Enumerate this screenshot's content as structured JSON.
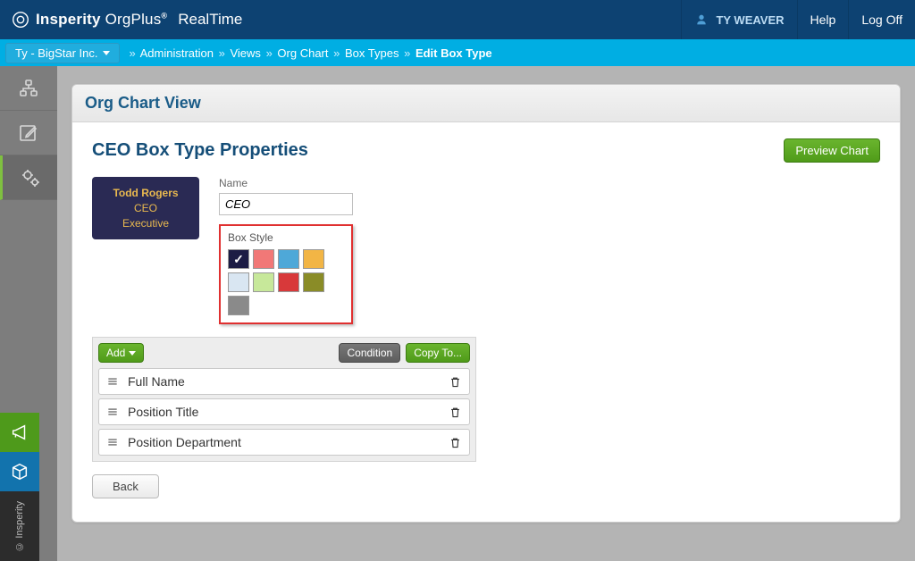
{
  "header": {
    "brand_bold": "Insperity",
    "brand_reg": "OrgPlus",
    "brand_app": "RealTime",
    "user": "TY WEAVER",
    "help": "Help",
    "logoff": "Log Off"
  },
  "breadcrumb": {
    "company": "Ty - BigStar Inc.",
    "items": [
      "Administration",
      "Views",
      "Org Chart",
      "Box Types",
      "Edit Box Type"
    ]
  },
  "sidebar": {
    "copyright": "© Insperity"
  },
  "panel": {
    "header": "Org Chart View",
    "title": "CEO Box Type Properties",
    "preview_btn": "Preview Chart",
    "back": "Back"
  },
  "preview": {
    "name": "Todd Rogers",
    "title": "CEO",
    "dept": "Executive"
  },
  "form": {
    "name_label": "Name",
    "name_value": "CEO",
    "box_style_label": "Box Style",
    "swatches": [
      {
        "color": "#1c1c44",
        "selected": true
      },
      {
        "color": "#f17877"
      },
      {
        "color": "#4ea8d8"
      },
      {
        "color": "#f2b545"
      },
      {
        "color": "#d9e6f2"
      },
      {
        "color": "#c7e89a"
      },
      {
        "color": "#d8393a"
      },
      {
        "color": "#8a8c27"
      },
      {
        "color": "#8a8a8a"
      }
    ]
  },
  "fields": {
    "add": "Add",
    "condition": "Condition",
    "copy": "Copy To...",
    "rows": [
      "Full Name",
      "Position Title",
      "Position Department"
    ]
  }
}
